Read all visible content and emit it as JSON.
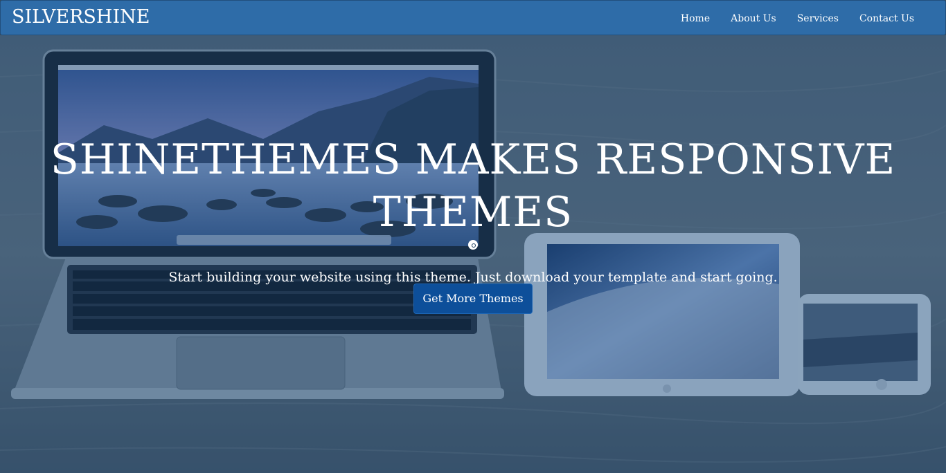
{
  "brand": "SILVERSHINE",
  "nav": {
    "items": [
      "Home",
      "About Us",
      "Services",
      "Contact Us"
    ]
  },
  "hero": {
    "headline_line1": "SHINETHEMES MAKES RESPONSIVE",
    "headline_line2": "THEMES",
    "subtitle": "Start building your website using this theme. Just download your template and start going.",
    "cta_label": "Get More Themes"
  },
  "colors": {
    "navbar": "#2e6ca8",
    "cta": "#0d4f9a",
    "overlay": "#124882"
  }
}
